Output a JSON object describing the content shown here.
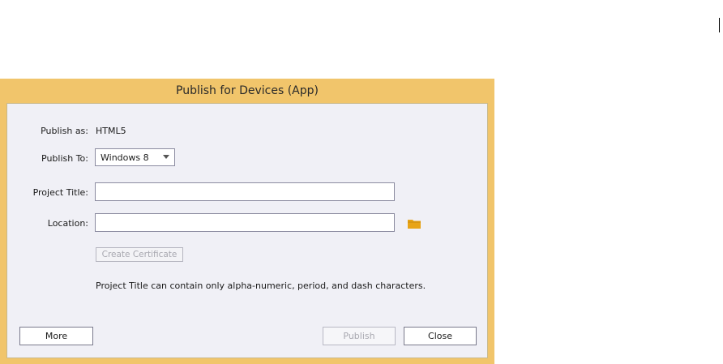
{
  "dialog": {
    "title": "Publish for Devices (App)"
  },
  "form": {
    "publish_as_label": "Publish as:",
    "publish_as_value": "HTML5",
    "publish_to_label": "Publish To:",
    "publish_to_selected": "Windows 8",
    "project_title_label": "Project Title:",
    "project_title_value": "",
    "location_label": "Location:",
    "location_value": "",
    "location_browse_icon": "folder-icon",
    "create_certificate_label": "Create Certificate",
    "note": "Project Title can contain only alpha-numeric, period, and dash characters."
  },
  "buttons": {
    "more_label": "More",
    "publish_label": "Publish",
    "close_label": "Close"
  },
  "colors": {
    "frame": "#f1c56b",
    "client": "#f0f0f6",
    "folder": "#e8a417"
  }
}
